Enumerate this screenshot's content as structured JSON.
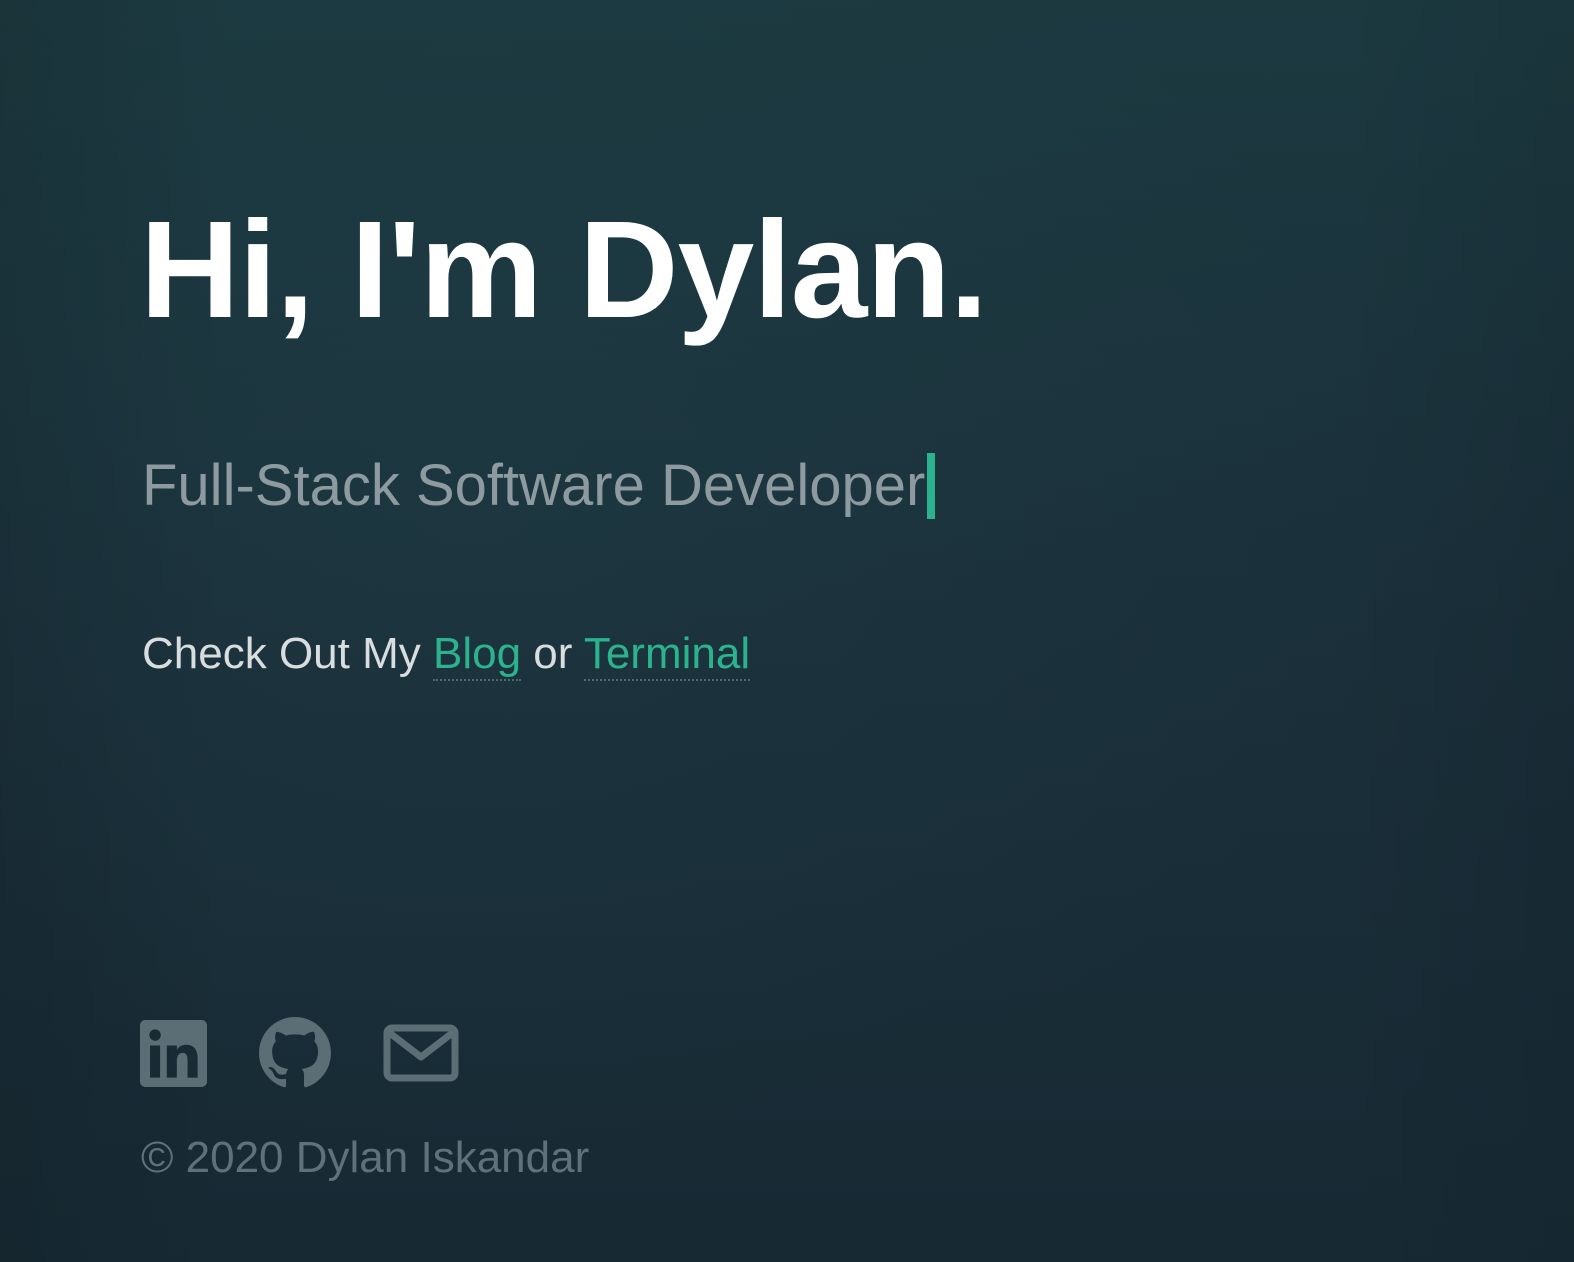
{
  "hero": {
    "headline": "Hi, I'm Dylan.",
    "subtitle": "Full-Stack Software Developer"
  },
  "links": {
    "prefix": "Check Out My ",
    "blog_label": "Blog",
    "separator": " or ",
    "terminal_label": "Terminal"
  },
  "social": {
    "items": [
      {
        "icon": "linkedin-icon"
      },
      {
        "icon": "github-icon"
      },
      {
        "icon": "mail-icon"
      }
    ]
  },
  "footer": {
    "copyright": "© 2020 Dylan Iskandar"
  },
  "colors": {
    "background": "#1a3038",
    "headline": "#ffffff",
    "subtitle": "#8d9ba1",
    "accent": "#2bb38e",
    "icons": "#5b6e75",
    "copyright": "#5f7279"
  }
}
